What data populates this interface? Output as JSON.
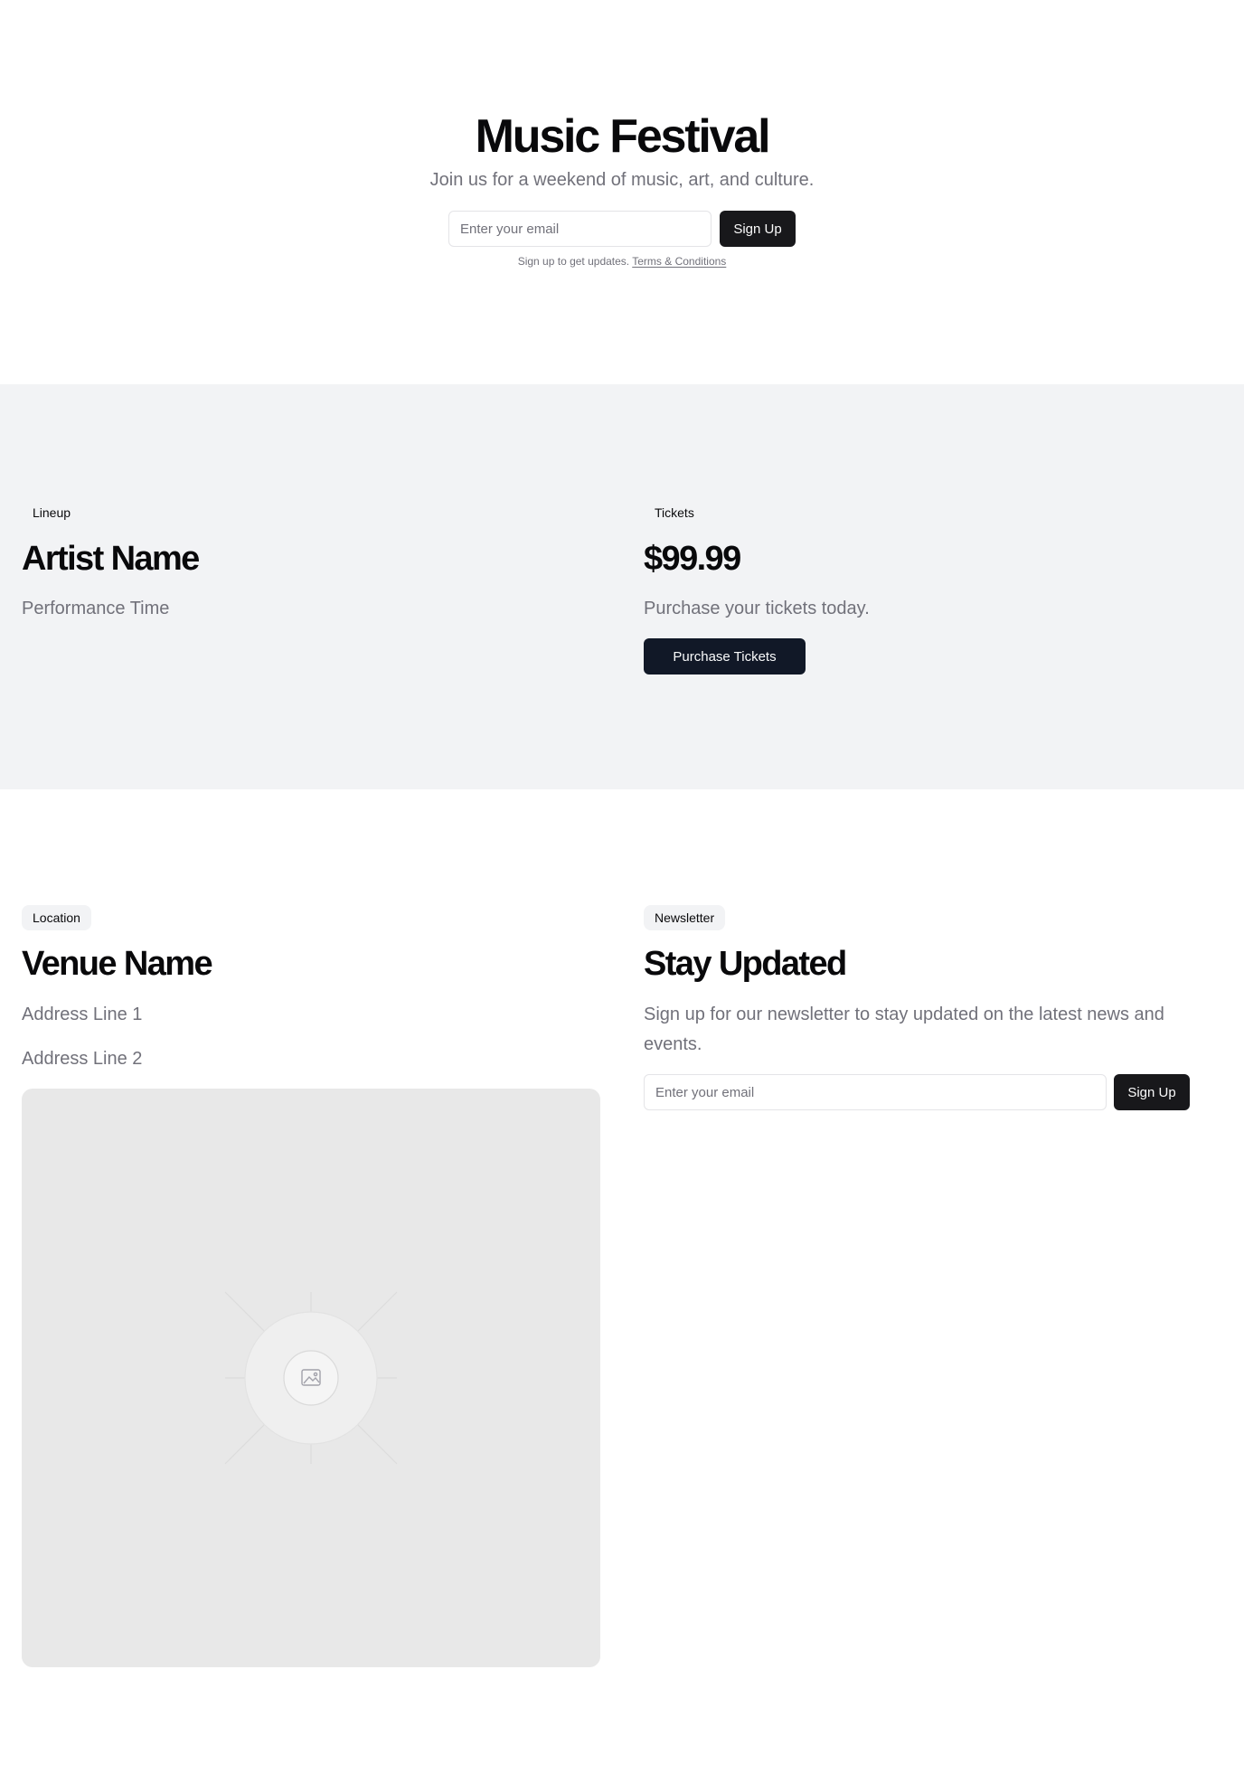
{
  "hero": {
    "title": "Music Festival",
    "subtitle": "Join us for a weekend of music, art, and culture.",
    "email_placeholder": "Enter your email",
    "signup_label": "Sign Up",
    "note_text": "Sign up to get updates. ",
    "terms_link": "Terms & Conditions"
  },
  "lineup": {
    "tag": "Lineup",
    "artist": "Artist Name",
    "time": "Performance Time"
  },
  "tickets": {
    "tag": "Tickets",
    "price": "$99.99",
    "description": "Purchase your tickets today.",
    "button_label": "Purchase Tickets"
  },
  "location": {
    "tag": "Location",
    "venue": "Venue Name",
    "address_line_1": "Address Line 1",
    "address_line_2": "Address Line 2",
    "map_icon": "image-placeholder-icon"
  },
  "newsletter": {
    "tag": "Newsletter",
    "title": "Stay Updated",
    "description": "Sign up for our newsletter to stay updated on the latest news and events.",
    "email_placeholder": "Enter your email",
    "signup_label": "Sign Up"
  },
  "colors": {
    "accent_dark": "#18181b",
    "navy_button": "#111827",
    "band_background": "#f2f3f5",
    "muted_text": "#71717a"
  }
}
